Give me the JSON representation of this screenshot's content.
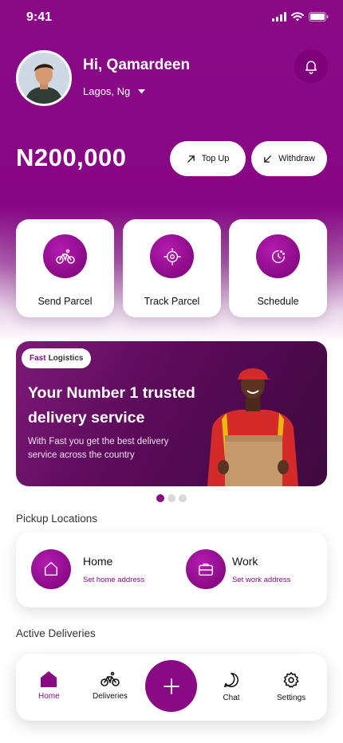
{
  "status": {
    "time": "9:41"
  },
  "header": {
    "greeting": "Hi, Qamardeen",
    "location": "Lagos, Ng"
  },
  "wallet": {
    "balance": "N200,000",
    "topup_label": "Top Up",
    "withdraw_label": "Withdraw"
  },
  "actions": [
    {
      "label": "Send Parcel",
      "icon": "bicycle-icon"
    },
    {
      "label": "Track Parcel",
      "icon": "target-icon"
    },
    {
      "label": "Schedule",
      "icon": "clock-icon"
    }
  ],
  "banner": {
    "badge_brand": "Fast",
    "badge_rest": "Logistics",
    "title": "Your Number 1 trusted delivery service",
    "subtitle": "With Fast you get the best delivery service across the country",
    "active_slide": 1,
    "slides": 3
  },
  "pickup": {
    "heading": "Pickup Locations",
    "home": {
      "title": "Home",
      "link": "Set home address"
    },
    "work": {
      "title": "Work",
      "link": "Set work address"
    }
  },
  "deliveries": {
    "heading": "Active Deliveries"
  },
  "nav": {
    "items": [
      {
        "label": "Home",
        "active": true
      },
      {
        "label": "Deliveries"
      },
      {
        "label": "Chat"
      },
      {
        "label": "Settings"
      }
    ]
  },
  "colors": {
    "brand": "#8a0a86",
    "white": "#ffffff"
  }
}
